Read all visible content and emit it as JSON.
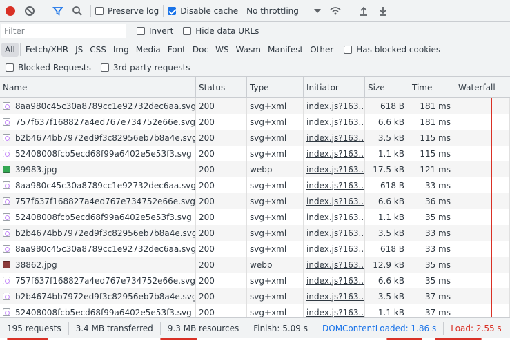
{
  "toolbar": {
    "preserve_log_label": "Preserve log",
    "disable_cache_label": "Disable cache",
    "throttling_label": "No throttling"
  },
  "filterbar": {
    "filter_placeholder": "Filter",
    "invert_label": "Invert",
    "hide_data_urls_label": "Hide data URLs"
  },
  "types": [
    "All",
    "Fetch/XHR",
    "JS",
    "CSS",
    "Img",
    "Media",
    "Font",
    "Doc",
    "WS",
    "Wasm",
    "Manifest",
    "Other"
  ],
  "has_blocked_cookies_label": "Has blocked cookies",
  "blocked_requests_label": "Blocked Requests",
  "third_party_label": "3rd-party requests",
  "columns": {
    "name": "Name",
    "status": "Status",
    "type": "Type",
    "initiator": "Initiator",
    "size": "Size",
    "time": "Time",
    "waterfall": "Waterfall"
  },
  "rows": [
    {
      "name": "8aa980c45c30a8789cc1e92732dec6aa.svg",
      "status": "200",
      "type": "svg+xml",
      "initiator": "index.js?163...",
      "size": "618 B",
      "time": "181 ms",
      "icon": "svg"
    },
    {
      "name": "757f637f168827a4ed767e734752e66e.svg",
      "status": "200",
      "type": "svg+xml",
      "initiator": "index.js?163...",
      "size": "6.6 kB",
      "time": "181 ms",
      "icon": "svg"
    },
    {
      "name": "b2b4674bb7972ed9f3c82956eb7b8a4e.svg",
      "status": "200",
      "type": "svg+xml",
      "initiator": "index.js?163...",
      "size": "3.5 kB",
      "time": "115 ms",
      "icon": "svg"
    },
    {
      "name": "52408008fcb5ecd68f99a6402e5e53f3.svg",
      "status": "200",
      "type": "svg+xml",
      "initiator": "index.js?163...",
      "size": "1.1 kB",
      "time": "115 ms",
      "icon": "svg"
    },
    {
      "name": "39983.jpg",
      "status": "200",
      "type": "webp",
      "initiator": "index.js?163...",
      "size": "17.5 kB",
      "time": "121 ms",
      "icon": "img"
    },
    {
      "name": "8aa980c45c30a8789cc1e92732dec6aa.svg",
      "status": "200",
      "type": "svg+xml",
      "initiator": "index.js?163...",
      "size": "618 B",
      "time": "33 ms",
      "icon": "svg"
    },
    {
      "name": "757f637f168827a4ed767e734752e66e.svg",
      "status": "200",
      "type": "svg+xml",
      "initiator": "index.js?163...",
      "size": "6.6 kB",
      "time": "36 ms",
      "icon": "svg"
    },
    {
      "name": "52408008fcb5ecd68f99a6402e5e53f3.svg",
      "status": "200",
      "type": "svg+xml",
      "initiator": "index.js?163...",
      "size": "1.1 kB",
      "time": "35 ms",
      "icon": "svg"
    },
    {
      "name": "b2b4674bb7972ed9f3c82956eb7b8a4e.svg",
      "status": "200",
      "type": "svg+xml",
      "initiator": "index.js?163...",
      "size": "3.5 kB",
      "time": "33 ms",
      "icon": "svg"
    },
    {
      "name": "8aa980c45c30a8789cc1e92732dec6aa.svg",
      "status": "200",
      "type": "svg+xml",
      "initiator": "index.js?163...",
      "size": "618 B",
      "time": "33 ms",
      "icon": "svg"
    },
    {
      "name": "38862.jpg",
      "status": "200",
      "type": "webp",
      "initiator": "index.js?163...",
      "size": "12.9 kB",
      "time": "35 ms",
      "icon": "img2"
    },
    {
      "name": "757f637f168827a4ed767e734752e66e.svg",
      "status": "200",
      "type": "svg+xml",
      "initiator": "index.js?163...",
      "size": "6.6 kB",
      "time": "35 ms",
      "icon": "svg"
    },
    {
      "name": "b2b4674bb7972ed9f3c82956eb7b8a4e.svg",
      "status": "200",
      "type": "svg+xml",
      "initiator": "index.js?163...",
      "size": "3.5 kB",
      "time": "37 ms",
      "icon": "svg"
    },
    {
      "name": "52408008fcb5ecd68f99a6402e5e53f3.svg",
      "status": "200",
      "type": "svg+xml",
      "initiator": "index.js?163...",
      "size": "1.1 kB",
      "time": "37 ms",
      "icon": "svg"
    }
  ],
  "statusbar": {
    "requests": "195 requests",
    "transferred": "3.4 MB transferred",
    "resources": "9.3 MB resources",
    "finish": "Finish: 5.09 s",
    "dcl": "DOMContentLoaded: 1.86 s",
    "load": "Load: 2.55 s"
  },
  "colors": {
    "record": "#d93025",
    "accent": "#1a73e8",
    "dcl_line": "#1a73e8",
    "load_line": "#d93025"
  }
}
